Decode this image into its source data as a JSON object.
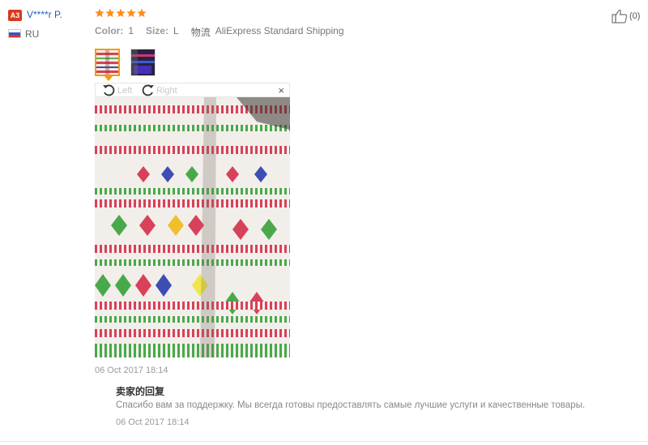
{
  "user": {
    "level_badge": "A3",
    "name": "V****r P.",
    "country": "RU",
    "flag_colors": [
      "#ffffff",
      "#2b58c8",
      "#e0302a"
    ]
  },
  "review": {
    "rating": 5,
    "star_color": "#ff8c1a",
    "color_label": "Color:",
    "color_value": "1",
    "size_label": "Size:",
    "size_value": "L",
    "logistics_label": "物流",
    "logistics_value": "AliExpress Standard Shipping",
    "helpful_count": "(0)",
    "date": "06 Oct 2017 18:14"
  },
  "viewer": {
    "rotate_left_label": "Left",
    "rotate_right_label": "Right",
    "close_label": "×"
  },
  "seller_reply": {
    "title": "卖家的回复",
    "text": "Спасибо вам за поддержку. Мы всегда готовы предоставлять самые лучшие услуги и качественные товары.",
    "date": "06 Oct 2017 18:14"
  }
}
